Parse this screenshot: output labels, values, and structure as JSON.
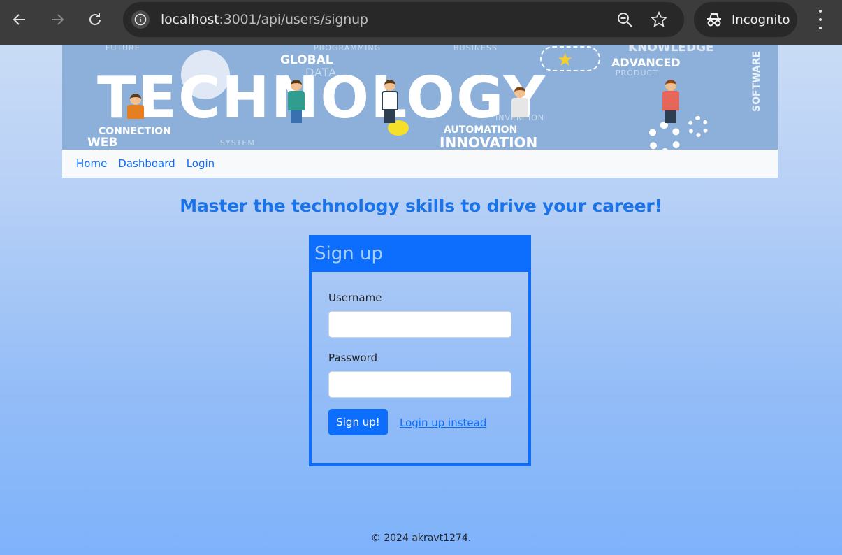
{
  "browser": {
    "url_host": "localhost",
    "url_rest": ":3001/api/users/signup",
    "incognito_label": "Incognito"
  },
  "banner": {
    "main_word": "TECHNOLOGY",
    "words": {
      "global": "GLOBAL",
      "advanced": "ADVANCED",
      "connection": "CONNECTION",
      "web": "WEB",
      "automation": "AUTOMATION",
      "innovation": "INNOVATION",
      "software": "SOFTWARE",
      "programming": "PROGRAMMING",
      "knowledge": "KNOWLEDGE",
      "data": "DATA",
      "system": "SYSTEM",
      "invention": "INVENTION",
      "product": "PRODUCT",
      "business": "BUSINESS",
      "future": "FUTURE"
    }
  },
  "nav": {
    "home": "Home",
    "dashboard": "Dashboard",
    "login": "Login"
  },
  "headline": "Master the technology skills to drive your career!",
  "signup_card": {
    "title": "Sign up",
    "username_label": "Username",
    "username_value": "",
    "password_label": "Password",
    "password_value": "",
    "submit_label": "Sign up!",
    "alt_link": "Login up instead"
  },
  "footer": "© 2024 akravt1274.",
  "colors": {
    "primary": "#0d6efd",
    "chrome_bg": "#3c3c3c",
    "banner_bg": "#8cb0d9"
  }
}
